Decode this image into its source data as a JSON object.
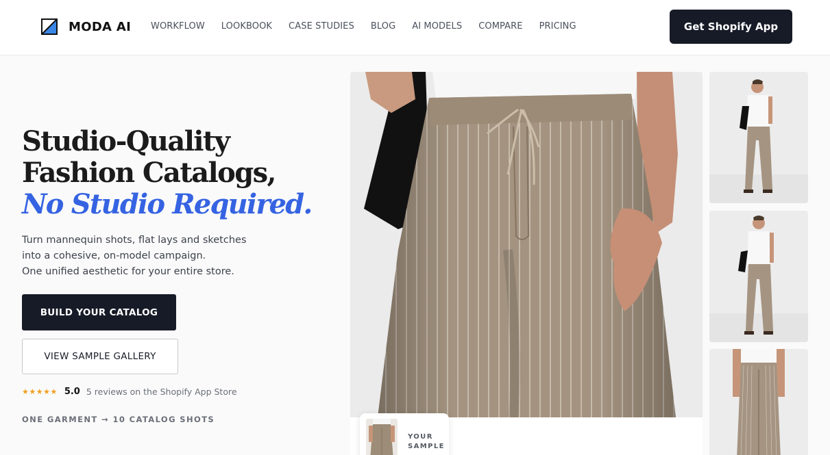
{
  "brand": {
    "name": "MODA AI",
    "logo_icon": "square-diagonal-logo-icon",
    "accent_color": "#3563e2",
    "dark_color": "#161b27"
  },
  "nav": {
    "items": [
      {
        "label": "WORKFLOW"
      },
      {
        "label": "LOOKBOOK"
      },
      {
        "label": "CASE STUDIES"
      },
      {
        "label": "BLOG"
      },
      {
        "label": "AI MODELS"
      },
      {
        "label": "COMPARE"
      },
      {
        "label": "PRICING"
      }
    ],
    "cta_label": "Get Shopify App"
  },
  "hero": {
    "headline_line1": "Studio-Quality",
    "headline_line2": "Fashion Catalogs,",
    "headline_accent": "No Studio Required.",
    "subtext_line1": "Turn mannequin shots, flat lays and sketches",
    "subtext_line2": "into a cohesive, on-model campaign.",
    "subtext_line3": "One unified aesthetic for your entire store.",
    "primary_button": "BUILD YOUR CATALOG",
    "secondary_button": "VIEW SAMPLE GALLERY",
    "rating": {
      "stars": "★★★★★",
      "stars_value": 5,
      "score": "5.0",
      "text": "5 reviews on the Shopify App Store",
      "star_color": "#f0a020"
    },
    "tagline": "ONE GARMENT → 10 CATALOG SHOTS"
  },
  "gallery": {
    "sample_label_line1": "YOUR",
    "sample_label_line2": "SAMPLE"
  }
}
